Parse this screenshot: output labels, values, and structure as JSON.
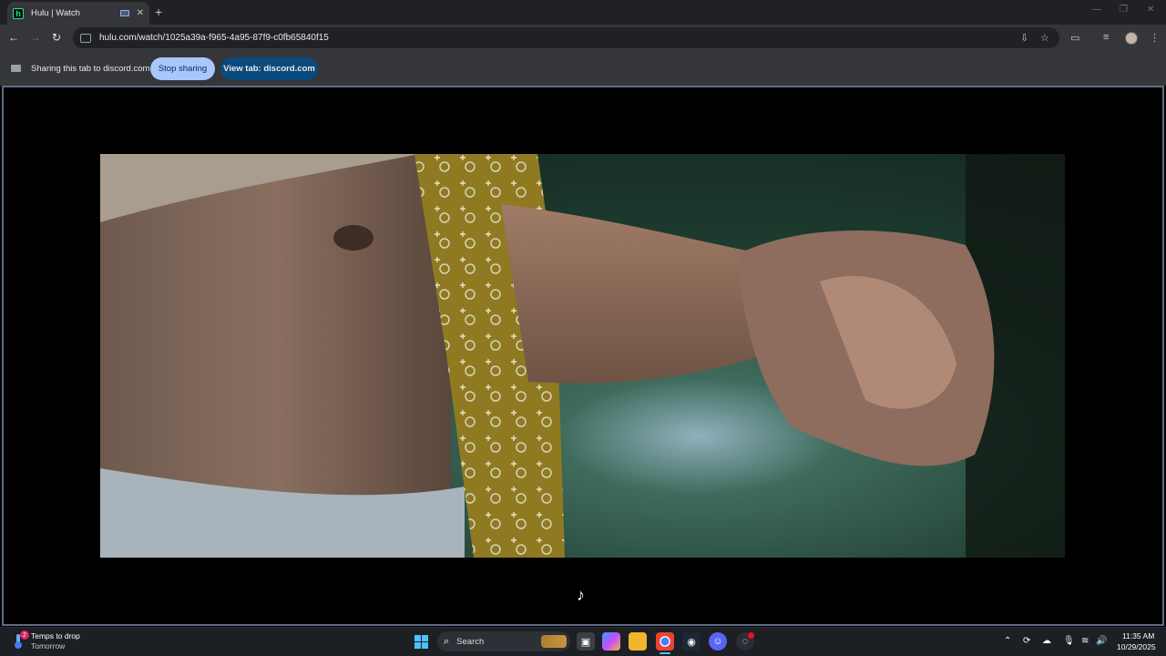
{
  "browser": {
    "tab": {
      "title": "Hulu | Watch",
      "favicon": "h"
    },
    "url": "hulu.com/watch/1025a39a-f965-4a95-87f9-c0fb65840f15"
  },
  "sharing": {
    "message": "Sharing this tab to discord.com",
    "stop_label": "Stop sharing",
    "view_label": "View tab: discord.com"
  },
  "taskbar": {
    "weather": {
      "title": "Temps to drop",
      "subtitle": "Tomorrow",
      "badge": "2"
    },
    "search_label": "Search",
    "clock": {
      "time": "11:35 AM",
      "date": "10/29/2025"
    }
  },
  "icons": {
    "music": "music-note-icon"
  }
}
